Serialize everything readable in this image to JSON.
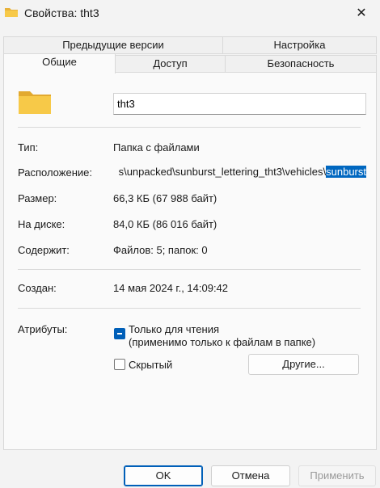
{
  "window": {
    "title": "Свойства: tht3",
    "close_glyph": "✕"
  },
  "tabs": {
    "row1": [
      "Предыдущие версии",
      "Настройка"
    ],
    "row2": [
      "Общие",
      "Доступ",
      "Безопасность"
    ],
    "active": "Общие"
  },
  "general": {
    "name_value": "tht3",
    "type_label": "Тип:",
    "type_value": "Папка с файлами",
    "location_label": "Расположение:",
    "location_value": "s\\unpacked\\sunburst_lettering_tht3\\vehicles\\",
    "location_selected": "sunburst",
    "size_label": "Размер:",
    "size_value": "66,3 КБ (67 988 байт)",
    "disk_label": "На диске:",
    "disk_value": "84,0 КБ (86 016 байт)",
    "contains_label": "Содержит:",
    "contains_value": "Файлов: 5; папок: 0",
    "created_label": "Создан:",
    "created_value": "14 мая 2024 г., 14:09:42",
    "attributes_label": "Атрибуты:",
    "readonly_label": "Только для чтения",
    "readonly_note": "(применимо только к файлам в папке)",
    "readonly_state": "indeterminate",
    "hidden_label": "Скрытый",
    "hidden_checked": false,
    "other_button": "Другие..."
  },
  "footer": {
    "ok": "OK",
    "cancel": "Отмена",
    "apply": "Применить"
  },
  "colors": {
    "folder": "#f7c948",
    "accent": "#005fb8",
    "selection": "#0067c0"
  },
  "icons": [
    "folder-icon",
    "close-icon",
    "large-folder-icon"
  ]
}
